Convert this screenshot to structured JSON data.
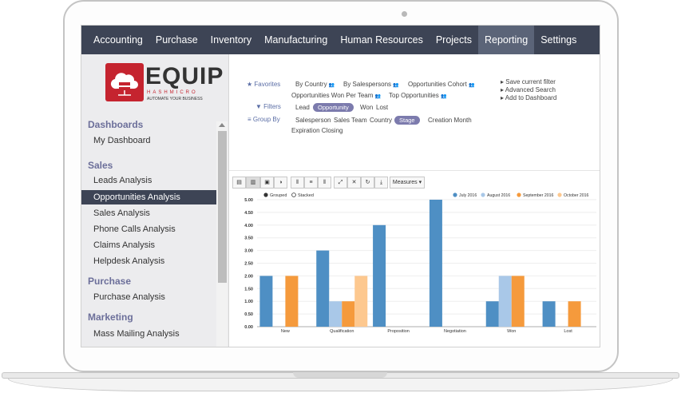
{
  "nav": {
    "items": [
      "Accounting",
      "Purchase",
      "Inventory",
      "Manufacturing",
      "Human Resources",
      "Projects",
      "Reporting",
      "Settings"
    ],
    "active": "Reporting"
  },
  "logo": {
    "name": "EQUIP",
    "sub": "HASHMICRO",
    "tagline": "AUTOMATE YOUR BUSINESS"
  },
  "sidebar": {
    "sections": [
      {
        "title": "Dashboards",
        "items": [
          "My Dashboard"
        ]
      },
      {
        "title": "Sales",
        "items": [
          "Leads Analysis",
          "Opportunities Analysis",
          "Sales Analysis",
          "Phone Calls Analysis",
          "Claims Analysis",
          "Helpdesk Analysis"
        ]
      },
      {
        "title": "Purchase",
        "items": [
          "Purchase Analysis"
        ]
      },
      {
        "title": "Marketing",
        "items": [
          "Mass Mailing Analysis"
        ]
      }
    ],
    "active_item": "Opportunities Analysis"
  },
  "search": {
    "favorites_label": "Favorites",
    "favorites": [
      "By Country",
      "By Salespersons",
      "Opportunities Cohort",
      "Opportunities Won Per Team",
      "Top Opportunities"
    ],
    "filters_label": "Filters",
    "filters": [
      "Lead",
      "Opportunity",
      "Won",
      "Lost"
    ],
    "groupby_label": "Group By",
    "groupby": [
      "Salesperson",
      "Sales Team",
      "Country",
      "Stage",
      "Creation Month",
      "Expiration Closing"
    ],
    "active_filter": "Opportunity",
    "active_group": "Stage",
    "actions": [
      "Save current filter",
      "Advanced Search",
      "Add to Dashboard"
    ]
  },
  "toolbar": {
    "measures_label": "Measures"
  },
  "chart_data": {
    "type": "bar",
    "mode_options": [
      "Grouped",
      "Stacked"
    ],
    "mode": "Grouped",
    "categories": [
      "New",
      "Qualification",
      "Proposition",
      "Negotiation",
      "Won",
      "Lost"
    ],
    "series": [
      {
        "name": "July 2016",
        "color": "#4e8fc4",
        "values": [
          2,
          3,
          4,
          5,
          1,
          1
        ]
      },
      {
        "name": "August 2016",
        "color": "#a9c8e8",
        "values": [
          0,
          1,
          0,
          0,
          2,
          0
        ]
      },
      {
        "name": "September 2016",
        "color": "#f59a3c",
        "values": [
          2,
          1,
          0,
          0,
          2,
          1
        ]
      },
      {
        "name": "October 2016",
        "color": "#fdc88f",
        "values": [
          0,
          2,
          0,
          0,
          0,
          0
        ]
      }
    ],
    "yticks": [
      "0.00",
      "0.50",
      "1.00",
      "1.50",
      "2.00",
      "2.50",
      "3.00",
      "3.50",
      "4.00",
      "4.50",
      "5.00"
    ],
    "ylim": [
      0,
      5
    ],
    "legend": "top-right",
    "grid": true
  }
}
